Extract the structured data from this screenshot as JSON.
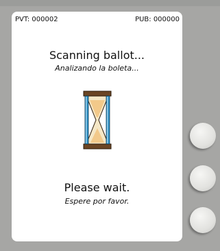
{
  "counters": {
    "pvt": "PVT: 000002",
    "pub": "PUB: 000000"
  },
  "status": {
    "title_en": "Scanning ballot...",
    "title_es": "Analizando la boleta...",
    "wait_en": "Please wait.",
    "wait_es": "Espere por favor."
  },
  "icons": {
    "status_icon": "hourglass-icon"
  },
  "colors": {
    "bezel": "#a6a6a4",
    "screen": "#ffffff",
    "hourglass_frame": "#5a3a1c",
    "hourglass_sand": "#f2c98a"
  }
}
